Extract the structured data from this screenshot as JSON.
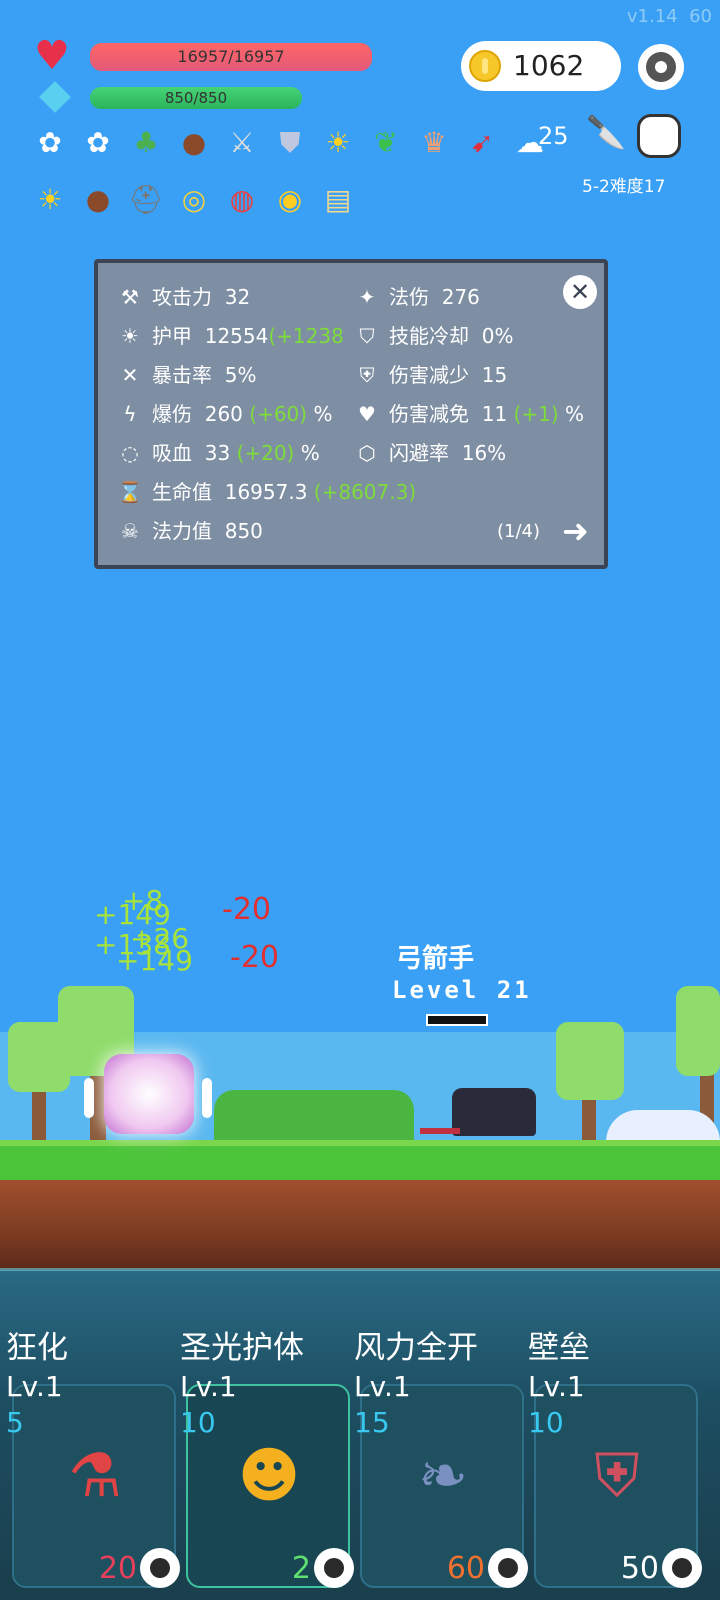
{
  "version": "v1.14",
  "fps": "60",
  "player": {
    "hp_text": "16957/16957",
    "hp_fraction": 1.0,
    "mp_text": "850/850",
    "mp_fraction": 1.0
  },
  "coins": "1062",
  "item_count_badge": "25",
  "stage": "5-2难度17",
  "items_row1": [
    "flower-icon",
    "flower-icon",
    "sapling-icon",
    "mushroom-icon",
    "sword-icon",
    "shield-icon",
    "sun-icon",
    "potted-plant-icon",
    "crown-icon",
    "sneaker-icon",
    "wing-icon"
  ],
  "items_row2": [
    "sun-icon",
    "mushroom-icon",
    "helmet-icon",
    "ring-icon",
    "pill-icon",
    "egg-icon",
    "scroll-icon"
  ],
  "stats": {
    "attack_label": "攻击力",
    "attack_value": "32",
    "magic_label": "法伤",
    "magic_value": "276",
    "armor_label": "护甲",
    "armor_value": "12554",
    "armor_bonus": "(+1238",
    "cooldown_label": "技能冷却",
    "cooldown_value": "0%",
    "crit_rate_label": "暴击率",
    "crit_rate_value": "5%",
    "dmg_reduce_label": "伤害减少",
    "dmg_reduce_value": "15",
    "crit_dmg_label": "爆伤",
    "crit_dmg_value": "260",
    "crit_dmg_bonus": "(+60)",
    "crit_dmg_unit": "%",
    "dmg_immune_label": "伤害减免",
    "dmg_immune_value": "11",
    "dmg_immune_bonus": "(+1)",
    "dmg_immune_unit": "%",
    "lifesteal_label": "吸血",
    "lifesteal_value": "33",
    "lifesteal_bonus": "(+20)",
    "lifesteal_unit": "%",
    "dodge_label": "闪避率",
    "dodge_value": "16%",
    "hp_label": "生命值",
    "hp_value": "16957.3",
    "hp_bonus": "(+8607.3)",
    "mp_label": "法力值",
    "mp_value": "850",
    "page": "(1/4)"
  },
  "battle": {
    "floats_green": [
      "+8",
      "+149",
      "+138",
      "+26",
      "+149"
    ],
    "floats_red": [
      "-20",
      "-20"
    ],
    "enemy_name": "弓箭手",
    "enemy_level": "Level 21",
    "enemy_hp_fraction": 1.0
  },
  "skills": [
    {
      "name": "狂化",
      "level": "Lv.1",
      "cost": "5",
      "count": "20",
      "count_color": "#e8405a",
      "icon": "potion-icon"
    },
    {
      "name": "圣光护体",
      "level": "Lv.1",
      "cost": "10",
      "count": "2",
      "count_color": "#60e070",
      "icon": "golden-trinity-icon"
    },
    {
      "name": "风力全开",
      "level": "Lv.1",
      "cost": "15",
      "count": "60",
      "count_color": "#f07030",
      "icon": "feather-icon"
    },
    {
      "name": "壁垒",
      "level": "Lv.1",
      "cost": "10",
      "count": "50",
      "count_color": "#ffffff",
      "icon": "armor-icon"
    }
  ]
}
